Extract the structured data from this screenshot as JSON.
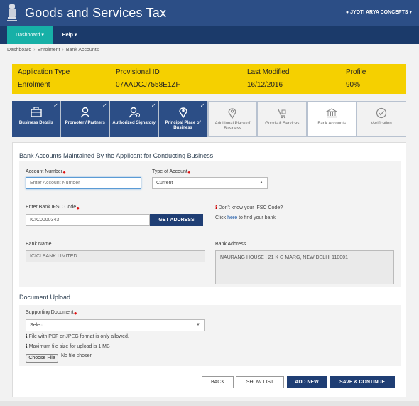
{
  "header": {
    "title": "Goods and Services Tax",
    "user": "JYOTI ARYA CONCEPTS",
    "emblem_icon": "national-emblem-icon"
  },
  "nav": {
    "dashboard": "Dashboard",
    "help": "Help"
  },
  "breadcrumb": [
    "Dashboard",
    "Enrolment",
    "Bank Accounts"
  ],
  "application": {
    "type_label": "Application Type",
    "type_value": "Enrolment",
    "provisional_label": "Provisional ID",
    "provisional_value": "07AADCJ7558E1ZF",
    "modified_label": "Last Modified",
    "modified_value": "16/12/2016",
    "profile_label": "Profile",
    "profile_value": "90%"
  },
  "steps": [
    {
      "label": "Business Details",
      "state": "done",
      "icon": "briefcase-icon"
    },
    {
      "label": "Promoter / Partners",
      "state": "done",
      "icon": "person-icon"
    },
    {
      "label": "Authorized Signatory",
      "state": "done",
      "icon": "signatory-icon"
    },
    {
      "label": "Principal Place of Business",
      "state": "done",
      "icon": "location-pin-icon"
    },
    {
      "label": "Additional Place of Business",
      "state": "todo",
      "icon": "location-pin-plus-icon"
    },
    {
      "label": "Goods & Services",
      "state": "todo",
      "icon": "goods-cart-icon"
    },
    {
      "label": "Bank Accounts",
      "state": "active",
      "icon": "bank-icon"
    },
    {
      "label": "Verification",
      "state": "todo",
      "icon": "check-circle-icon"
    }
  ],
  "bank_section": {
    "title": "Bank Accounts Maintained By the Applicant for Conducting Business",
    "account_number_label": "Account Number",
    "account_number_placeholder": "Enter Account Number",
    "account_type_label": "Type of Account",
    "account_type_value": "Current",
    "ifsc_label": "Enter Bank IFSC Code",
    "ifsc_value": "ICIC0000343",
    "get_address_button": "GET ADDRESS",
    "ifsc_help_question": "Don't know your IFSC Code?",
    "ifsc_help_click": "Click",
    "ifsc_help_here": "here",
    "ifsc_help_rest": "to find your bank",
    "bank_name_label": "Bank Name",
    "bank_name_value": "ICICI BANK LIMITED",
    "bank_address_label": "Bank Address",
    "bank_address_value": "NAURANG HOUSE , 21 K G MARG, NEW DELHI 110001"
  },
  "document_section": {
    "title": "Document Upload",
    "supporting_label": "Supporting Document",
    "supporting_value": "Select",
    "note_format": "File with PDF or JPEG format is only allowed.",
    "note_size": "Maximum file size for upload is 1 MB",
    "choose_file_button": "Choose File",
    "no_file_text": "No file chosen"
  },
  "actions": {
    "back": "BACK",
    "show_list": "SHOW LIST",
    "add_new": "ADD NEW",
    "save_continue": "SAVE & CONTINUE"
  },
  "colors": {
    "header_blue": "#2c4e86",
    "nav_teal": "#17b0a7",
    "banner_yellow": "#f5d000",
    "button_navy": "#1f3e74",
    "required_red": "#e01010"
  }
}
